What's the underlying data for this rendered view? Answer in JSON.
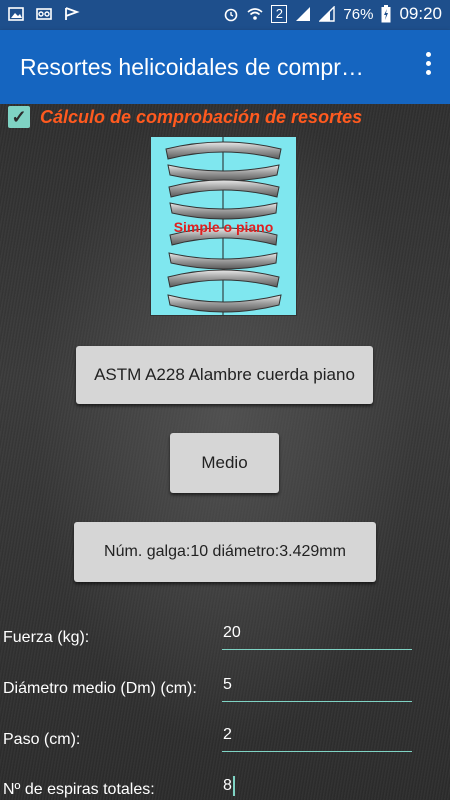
{
  "status_bar": {
    "battery": "76%",
    "time": "09:20",
    "sim_slot": "2"
  },
  "app_bar": {
    "title": "Resortes helicoidales de compr…"
  },
  "check": {
    "checked": true,
    "label": "Cálculo de comprobación de resortes"
  },
  "spring_image": {
    "caption": "Simple o piano"
  },
  "buttons": {
    "material": "ASTM A228 Alambre cuerda piano",
    "level": "Medio",
    "gauge": "Núm. galga:10  diámetro:3.429mm"
  },
  "fields": [
    {
      "label": "Fuerza (kg):",
      "value": "20"
    },
    {
      "label": "Diámetro medio (Dm) (cm):",
      "value": "5"
    },
    {
      "label": "Paso (cm):",
      "value": "2"
    },
    {
      "label": "Nº de espiras totales:",
      "value": "8"
    }
  ],
  "colors": {
    "status_bar": "#1e4f8c",
    "app_bar": "#1565c0",
    "accent": "#7fd3c4",
    "check_label": "#ff5a1f"
  }
}
